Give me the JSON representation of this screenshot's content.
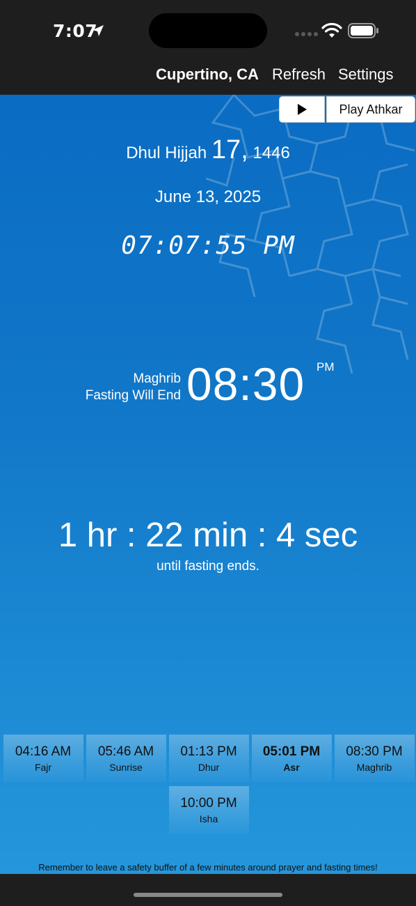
{
  "status_bar": {
    "time": "7:07",
    "icons": [
      "location-arrow-icon",
      "signal-icon",
      "wifi-icon",
      "battery-icon"
    ]
  },
  "nav": {
    "location": "Cupertino, CA",
    "refresh_label": "Refresh",
    "settings_label": "Settings"
  },
  "controls": {
    "play_icon": "play-icon",
    "athkar_label": "Play Athkar"
  },
  "dates": {
    "hijri_month": "Dhul Hijjah",
    "hijri_day": "17,",
    "hijri_year": "1446",
    "gregorian": "June 13, 2025",
    "clock": "07:07:55 PM"
  },
  "next_prayer": {
    "name": "Maghrib",
    "subtitle": "Fasting Will End",
    "time": "08:30",
    "ampm": "PM"
  },
  "countdown": {
    "text": "1 hr : 22 min : 4 sec",
    "caption": "until fasting ends."
  },
  "prayers": [
    {
      "time": "04:16 AM",
      "name": "Fajr"
    },
    {
      "time": "05:46 AM",
      "name": "Sunrise"
    },
    {
      "time": "01:13 PM",
      "name": "Dhur"
    },
    {
      "time": "05:01 PM",
      "name": "Asr",
      "active": true
    },
    {
      "time": "08:30 PM",
      "name": "Maghrib"
    },
    {
      "time": "10:00 PM",
      "name": "Isha"
    }
  ],
  "footer": {
    "note": "Remember to leave a safety buffer of a few minutes around prayer and fasting times!"
  },
  "colors": {
    "background_top": "#0a6cc3",
    "background_bottom": "#2596db",
    "bar": "#1e1e1e"
  }
}
